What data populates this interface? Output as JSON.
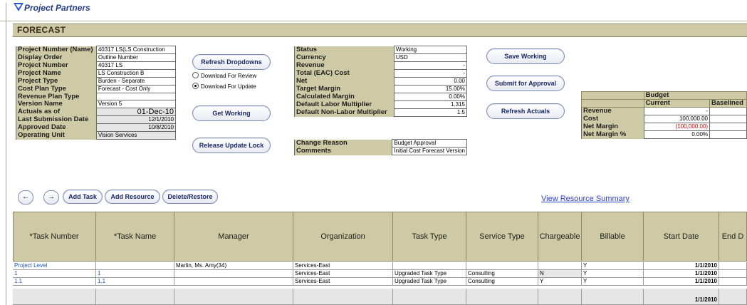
{
  "brand": {
    "name": "Project Partners"
  },
  "page": {
    "title": "FORECAST"
  },
  "project_info": [
    {
      "label": "Project Number (Name)",
      "value": "40317 LS(LS Construction"
    },
    {
      "label": "Display Order",
      "value": "Outline Number"
    },
    {
      "label": "Project Number",
      "value": "40317 LS"
    },
    {
      "label": "Project Name",
      "value": "LS Construction B"
    },
    {
      "label": "Project Type",
      "value": "Burden - Separate"
    },
    {
      "label": "Cost Plan Type",
      "value": "Forecast - Cost Only"
    },
    {
      "label": "Revenue Plan Type",
      "value": ""
    },
    {
      "label": "Version Name",
      "value": "Version 5"
    },
    {
      "label": "Actuals as of",
      "value": "01-Dec-10"
    },
    {
      "label": "Last Submission Date",
      "value": "12/1/2010"
    },
    {
      "label": "Approved Date",
      "value": "10/8/2010"
    },
    {
      "label": "Operating Unit",
      "value": "Vision Services"
    }
  ],
  "buttons": {
    "refresh_dropdowns": "Refresh Dropdowns",
    "get_working": "Get Working",
    "release_update_lock": "Release Update Lock",
    "save_working": "Save Working",
    "submit_for_approval": "Submit for Approval",
    "refresh_actuals": "Refresh Actuals",
    "add_task": "Add Task",
    "add_resource": "Add Resource",
    "delete_restore": "Delete/Restore"
  },
  "download_options": [
    {
      "label": "Download For Review",
      "selected": false
    },
    {
      "label": "Download For Update",
      "selected": true
    }
  ],
  "status_info": [
    {
      "label": "Status",
      "value": "Working"
    },
    {
      "label": "Currency",
      "value": "USD"
    },
    {
      "label": "Revenue",
      "value": "-"
    },
    {
      "label": "Total (EAC) Cost",
      "value": "-"
    },
    {
      "label": "Net",
      "value": "0.00"
    },
    {
      "label": "Target Margin",
      "value": "15.00%"
    },
    {
      "label": "Calculated Margin",
      "value": "0.00%"
    },
    {
      "label": "Default Labor Multiplier",
      "value": "1.315"
    },
    {
      "label": "Default Non-Labor Multiplier",
      "value": "1.5"
    }
  ],
  "change_info": [
    {
      "label": "Change Reason",
      "value": "Budget Approval"
    },
    {
      "label": "Comments",
      "value": "Initial Cost Forecast Version"
    }
  ],
  "budget": {
    "title": "Budget",
    "col_current": "Current",
    "col_baselined": "Baselined",
    "rows": [
      {
        "label": "Revenue",
        "current": "-"
      },
      {
        "label": "Cost",
        "current": "100,000.00"
      },
      {
        "label": "Net Margin",
        "current": "(100,000.00)"
      },
      {
        "label": "Net Margin %",
        "current": "0.00%"
      }
    ]
  },
  "nav": {
    "prev": "←",
    "next": "→"
  },
  "links": {
    "resource_summary": "View Resource Summary"
  },
  "task_table": {
    "headers": [
      "*Task Number",
      "*Task Name",
      "Manager",
      "Organization",
      "Task Type",
      "Service Type",
      "Chargeable",
      "Billable",
      "Start Date",
      "End D"
    ],
    "rows": [
      [
        "Project Level",
        "",
        "Marlin, Ms. Amy(34)",
        "Services-East",
        "",
        "",
        "",
        "Y",
        "1/1/2010",
        ""
      ],
      [
        "1",
        "1",
        "",
        "Services-East",
        "Upgraded Task Type",
        "Consulting",
        "N",
        "Y",
        "1/1/2010",
        ""
      ],
      [
        "1.1",
        "1.1",
        "",
        "Services-East",
        "Upgraded Task Type",
        "Consulting",
        "Y",
        "Y",
        "1/1/2010",
        ""
      ],
      [
        "",
        "",
        "",
        "",
        "",
        "",
        "",
        "",
        "1/1/2010",
        ""
      ]
    ]
  }
}
